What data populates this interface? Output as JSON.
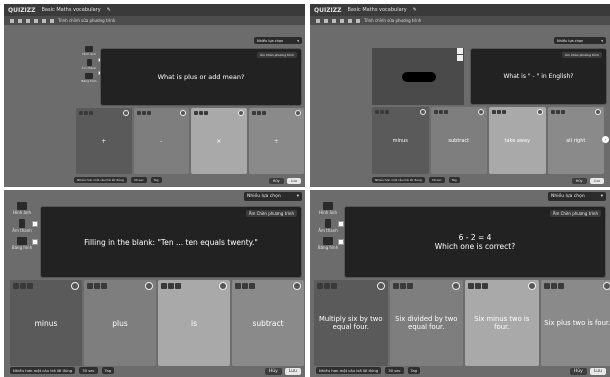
{
  "app": {
    "logo": "QUIZIZZ",
    "title": "Basic Maths vocabulary"
  },
  "toolbar": {
    "formula_label": "Trình chỉnh sửa phương trình"
  },
  "question_type": "Nhiều lựa chọn",
  "lang_button": "Âm Chèn phương trình",
  "sidebar": {
    "image": "Hình ảnh",
    "audio": "Âm thanh",
    "video": "Băng hình"
  },
  "footer": {
    "multi_answer": "Nhiều hơn một câu trả lời đúng",
    "time": "30 sec",
    "tag": "Tag",
    "cancel": "Hủy",
    "save": "Lưu"
  },
  "panels": [
    {
      "question": "What is plus or add mean?",
      "answers": [
        "+",
        "-",
        "×",
        "÷"
      ]
    },
    {
      "question": "What is \" - \" in English?",
      "answers": [
        "minus",
        "subtract",
        "take away",
        "all right"
      ]
    },
    {
      "question": "Filling in the blank: \"Ten ... ten equals twenty.\"",
      "answers": [
        "minus",
        "plus",
        "is",
        "subtract"
      ]
    },
    {
      "question_line1": "6 - 2 = 4",
      "question_line2": "Which one is correct?",
      "answers": [
        "Multiply six by two equal four.",
        "Six divided by two equal four.",
        "Six minus two is four.",
        "Six plus two is four."
      ]
    }
  ],
  "colors": {
    "panel_bg": "#6c6c6c",
    "question_bg": "#222222",
    "answer_dark": "#555555",
    "answer_mid": "#7e7e7e",
    "answer_light": "#a9a9a9"
  }
}
